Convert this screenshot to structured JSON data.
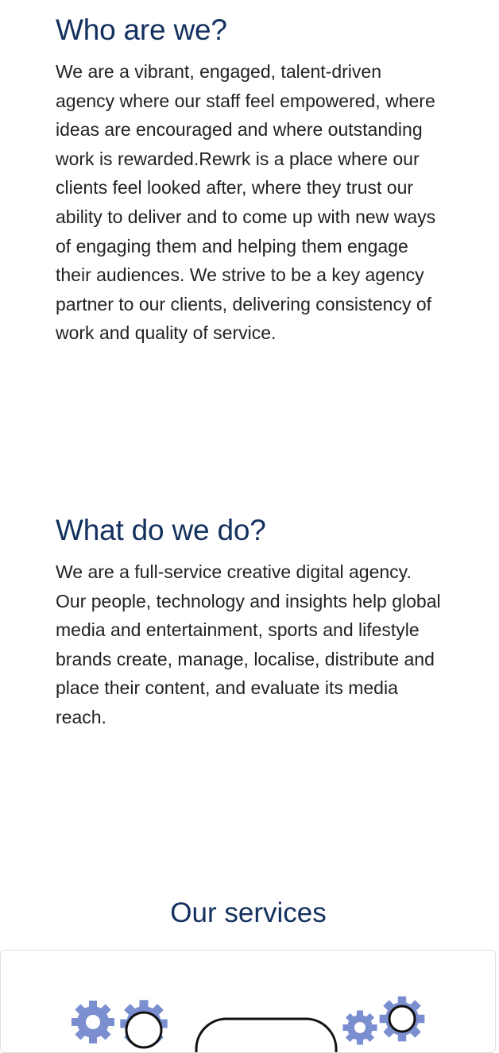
{
  "who": {
    "heading": "Who are we?",
    "body": "We are a vibrant, engaged, talent-driven agency where our staff feel empowered, where ideas are encouraged and where outstanding work is rewarded.Rewrk is a place where our clients feel looked after, where they trust our ability to deliver and to come up with new ways of engaging them and helping them engage their audiences. We strive to be a key agency partner to our clients, delivering consistency of work and quality of service."
  },
  "what": {
    "heading": "What do we do?",
    "body": "We are a full-service creative digital agency. Our people, technology and insights help global media and entertainment, sports and lifestyle brands create, manage, localise, distribute and place their content, and evaluate its media reach."
  },
  "services": {
    "heading": "Our services",
    "illustration_icon": "gears-icon"
  },
  "colors": {
    "heading": "#13305f",
    "body_text": "#222222",
    "gear": "#7b8fd0",
    "card_border": "#e0e0e0"
  }
}
